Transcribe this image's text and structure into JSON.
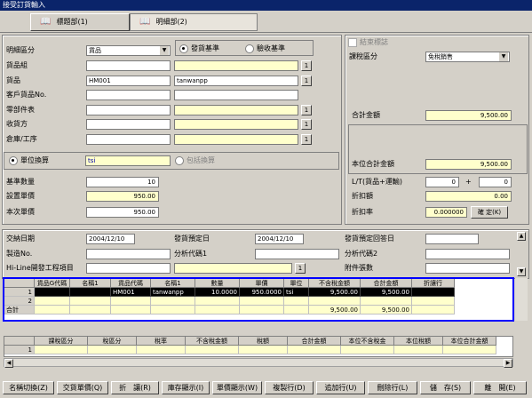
{
  "window": {
    "title": "接受訂貨輸入"
  },
  "tabs": [
    {
      "label": "標題部(1)"
    },
    {
      "label": "明細部(2)"
    }
  ],
  "left": {
    "detail_type_label": "明細區分",
    "detail_type_value": "貨品",
    "radio_ship": "發貨基準",
    "radio_check": "驗收基準",
    "item_group_label": "貨品組",
    "item_label": "貨品",
    "item_code": "HM001",
    "item_name": "tanwanpp",
    "customer_item_label": "客戶貨品No.",
    "parts_label": "零部件表",
    "receiver_label": "收貨方",
    "warehouse_label": "倉庫/工序",
    "unit_conv": "單位換算",
    "unit_value": "tsi",
    "pack_conv": "包括換算",
    "base_qty_label": "基準數量",
    "base_qty": "10",
    "set_price_label": "設置單價",
    "set_price": "950.00",
    "this_price_label": "本次單價",
    "this_price": "950.00"
  },
  "right": {
    "end_flag": "結束標誌",
    "tax_type_label": "課稅區分",
    "tax_type_value": "免稅銷售",
    "total_label": "合計金額",
    "total_value": "9,500.00",
    "local_total_label": "本位合計金額",
    "local_total_value": "9,500.00",
    "lt_label": "L/T(貨品+運輸)",
    "lt_a": "0",
    "lt_plus": "+",
    "lt_b": "0",
    "discount_amt_label": "折扣額",
    "discount_amt": "0.00",
    "discount_rate_label": "折扣率",
    "discount_rate": "0.000000",
    "confirm_btn": "確 定(K)"
  },
  "lower": {
    "delivery_date_label": "交納日期",
    "delivery_date": "2004/12/10",
    "ship_plan_label": "發貨預定日",
    "ship_plan": "2004/12/10",
    "ship_reply_label": "發貨預定回答日",
    "mfg_no_label": "製造No.",
    "analysis1_label": "分析代碼1",
    "analysis2_label": "分析代碼2",
    "hiline_label": "Hi-Line開發工程項目",
    "attach_label": "附件張數"
  },
  "grid1": {
    "headers": [
      "貨品G代碼",
      "名稱1",
      "貨品代碼",
      "名稱1",
      "數量",
      "單價",
      "單位",
      "不含稅金額",
      "合計金額",
      "折讓行"
    ],
    "rows": [
      {
        "no": "1",
        "cells": [
          "",
          "",
          "HM001",
          "tanwanpp",
          "10.0000",
          "950.0000",
          "tsi",
          "9,500.00",
          "9,500.00",
          ""
        ]
      },
      {
        "no": "2",
        "cells": [
          "",
          "",
          "",
          "",
          "",
          "",
          "",
          "",
          "",
          ""
        ]
      }
    ],
    "total_label": "合計",
    "total_cells": [
      "9,500.00",
      "9,500.00"
    ]
  },
  "grid2": {
    "headers": [
      "課稅區分",
      "稅區分",
      "稅率",
      "不含稅金額",
      "稅額",
      "合計金額",
      "本位不含稅金",
      "本位稅額",
      "本位合計金額"
    ],
    "row_no": "1"
  },
  "buttons": [
    "名稱切換(Z)",
    "交貨單價(Q)",
    "折　讓(R)",
    "庫存顯示(I)",
    "單價顯示(W)",
    "複製行(D)",
    "追加行(U)",
    "刪除行(L)",
    "儲　存(S)",
    "離　開(E)"
  ],
  "colors": {
    "highlight_row": "#000000",
    "selection_border": "#0000ff",
    "yellow_field": "#ffffcc",
    "title_bar": "#0a246a"
  }
}
